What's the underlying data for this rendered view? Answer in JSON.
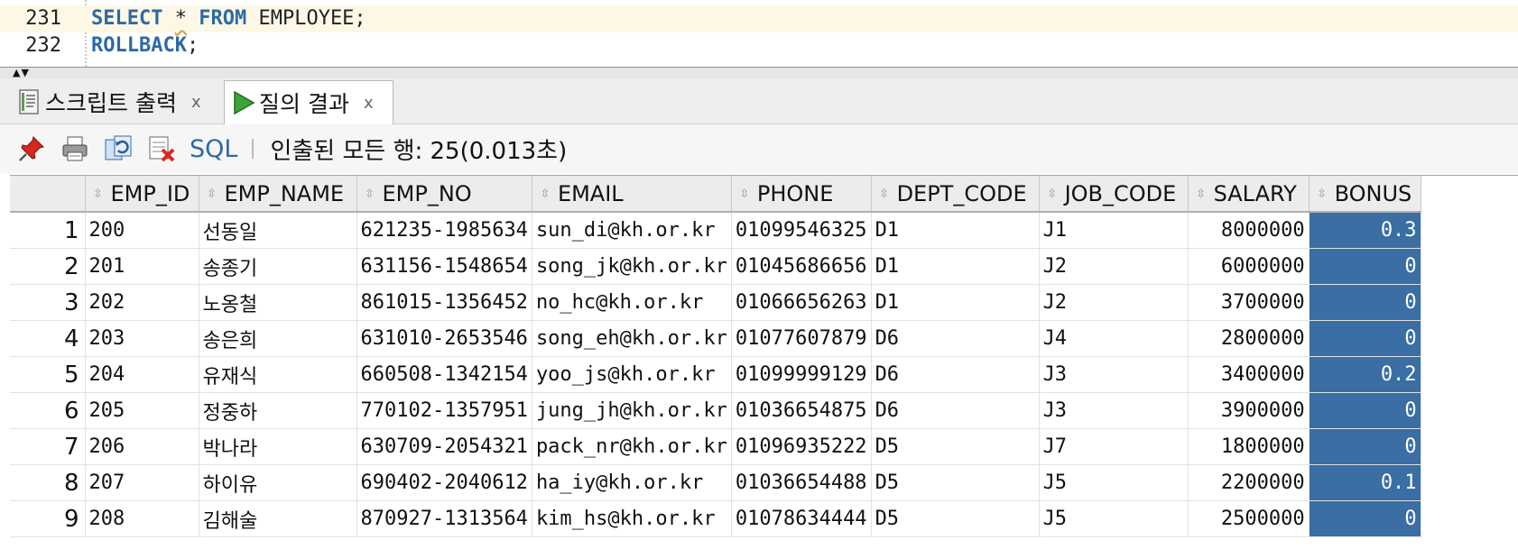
{
  "editor": {
    "lines": [
      {
        "number": "231",
        "keyword1": "SELECT",
        "star": "*",
        "keyword2": "FROM",
        "rest": "EMPLOYEE;"
      },
      {
        "number": "232",
        "keyword1": "ROLLBACK",
        "rest": ";"
      }
    ]
  },
  "splitter": {
    "arrows": "▲▼"
  },
  "tabs": [
    {
      "label": "스크립트 출력",
      "close": "x",
      "icon": "script-output-icon"
    },
    {
      "label": "질의 결과",
      "close": "x",
      "icon": "run-icon"
    }
  ],
  "toolbar": {
    "sql_label": "SQL",
    "status": "인출된 모든 행: 25(0.013초)",
    "icons": [
      "pin-icon",
      "print-icon",
      "refresh-icon",
      "clear-icon"
    ]
  },
  "colors": {
    "selection": "#3a6ea4",
    "keyword": "#2d6aa5",
    "current_line": "#fdf8e6"
  },
  "grid": {
    "columns": [
      "EMP_ID",
      "EMP_NAME",
      "EMP_NO",
      "EMAIL",
      "PHONE",
      "DEPT_CODE",
      "JOB_CODE",
      "SALARY",
      "BONUS"
    ],
    "rows": [
      {
        "rn": "1",
        "emp_id": "200",
        "emp_name": "선동일",
        "emp_no": "621235-1985634",
        "email": "sun_di@kh.or.kr",
        "phone": "01099546325",
        "dept": "D1",
        "job": "J1",
        "salary": "8000000",
        "bonus": "0.3"
      },
      {
        "rn": "2",
        "emp_id": "201",
        "emp_name": "송종기",
        "emp_no": "631156-1548654",
        "email": "song_jk@kh.or.kr",
        "phone": "01045686656",
        "dept": "D1",
        "job": "J2",
        "salary": "6000000",
        "bonus": "0"
      },
      {
        "rn": "3",
        "emp_id": "202",
        "emp_name": "노옹철",
        "emp_no": "861015-1356452",
        "email": "no_hc@kh.or.kr",
        "phone": "01066656263",
        "dept": "D1",
        "job": "J2",
        "salary": "3700000",
        "bonus": "0"
      },
      {
        "rn": "4",
        "emp_id": "203",
        "emp_name": "송은희",
        "emp_no": "631010-2653546",
        "email": "song_eh@kh.or.kr",
        "phone": "01077607879",
        "dept": "D6",
        "job": "J4",
        "salary": "2800000",
        "bonus": "0"
      },
      {
        "rn": "5",
        "emp_id": "204",
        "emp_name": "유재식",
        "emp_no": "660508-1342154",
        "email": "yoo_js@kh.or.kr",
        "phone": "01099999129",
        "dept": "D6",
        "job": "J3",
        "salary": "3400000",
        "bonus": "0.2"
      },
      {
        "rn": "6",
        "emp_id": "205",
        "emp_name": "정중하",
        "emp_no": "770102-1357951",
        "email": "jung_jh@kh.or.kr",
        "phone": "01036654875",
        "dept": "D6",
        "job": "J3",
        "salary": "3900000",
        "bonus": "0"
      },
      {
        "rn": "7",
        "emp_id": "206",
        "emp_name": "박나라",
        "emp_no": "630709-2054321",
        "email": "pack_nr@kh.or.kr",
        "phone": "01096935222",
        "dept": "D5",
        "job": "J7",
        "salary": "1800000",
        "bonus": "0"
      },
      {
        "rn": "8",
        "emp_id": "207",
        "emp_name": "하이유",
        "emp_no": "690402-2040612",
        "email": "ha_iy@kh.or.kr",
        "phone": "01036654488",
        "dept": "D5",
        "job": "J5",
        "salary": "2200000",
        "bonus": "0.1"
      },
      {
        "rn": "9",
        "emp_id": "208",
        "emp_name": "김해술",
        "emp_no": "870927-1313564",
        "email": "kim_hs@kh.or.kr",
        "phone": "01078634444",
        "dept": "D5",
        "job": "J5",
        "salary": "2500000",
        "bonus": "0"
      }
    ]
  }
}
